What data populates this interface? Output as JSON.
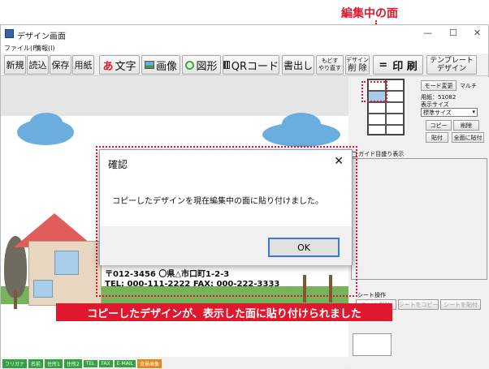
{
  "annotation": {
    "top_label": "編集中の面",
    "caption": "コピーしたデザインが、表示した面に貼り付けられました"
  },
  "window": {
    "title": "デザイン画面",
    "controls": [
      "—",
      "☐",
      "✕"
    ]
  },
  "menu": [
    "ファイル(F)",
    "情報(I)"
  ],
  "toolbar": {
    "new": "新規",
    "load": "読込",
    "save": "保存",
    "paper": "用紙",
    "text": "文字",
    "text_icon": "あ",
    "image": "画像",
    "shape": "図形",
    "qr": "QRコード",
    "writeout_top": "書出し",
    "undo_top": "もどす",
    "undo_bottom": "やり直す",
    "design_delete_top": "デザイン",
    "design_delete_bottom": "削 除",
    "eq_icon": "=",
    "print": "印 刷",
    "template_top": "テンプレート",
    "template_bottom": "デザイン"
  },
  "card": {
    "address": "〒012-3456  〇県△市口町1-2-3",
    "phone_fax": "TEL: 000-111-2222  FAX: 000-222-3333"
  },
  "fields": [
    {
      "label": "フリガナ",
      "color": "#33a142"
    },
    {
      "label": "名前",
      "color": "#33a142"
    },
    {
      "label": "住所1",
      "color": "#33a142"
    },
    {
      "label": "住所2",
      "color": "#33a142"
    },
    {
      "label": "TEL",
      "color": "#33a142"
    },
    {
      "label": "FAX",
      "color": "#33a142"
    },
    {
      "label": "E-MAIL",
      "color": "#33a142"
    },
    {
      "label": "背景画像",
      "color": "#e08a1e"
    }
  ],
  "panel": {
    "mode_change": "モード変更",
    "multi": "マルチ",
    "paper_code": "用紙：51082",
    "display_size_label": "表示サイズ",
    "display_size_value": "標準サイズ",
    "copy": "コピー",
    "delete": "削除",
    "paste": "貼付",
    "paste_all": "全面に貼付",
    "guide_checkbox": "ガイド目盛り表示",
    "sheet_op_label": "シート操作",
    "sheet_delete": "シート削除",
    "sheet_copy": "シートをコピー",
    "sheet_paste": "シートを貼付"
  },
  "dialog": {
    "title": "確認",
    "close": "✕",
    "message": "コピーしたデザインを現在編集中の面に貼り付けました。",
    "ok": "OK"
  },
  "colors": {
    "accent_red": "#e0182d",
    "selected_cell": "#a8ccea",
    "grass": "#77b35a"
  }
}
